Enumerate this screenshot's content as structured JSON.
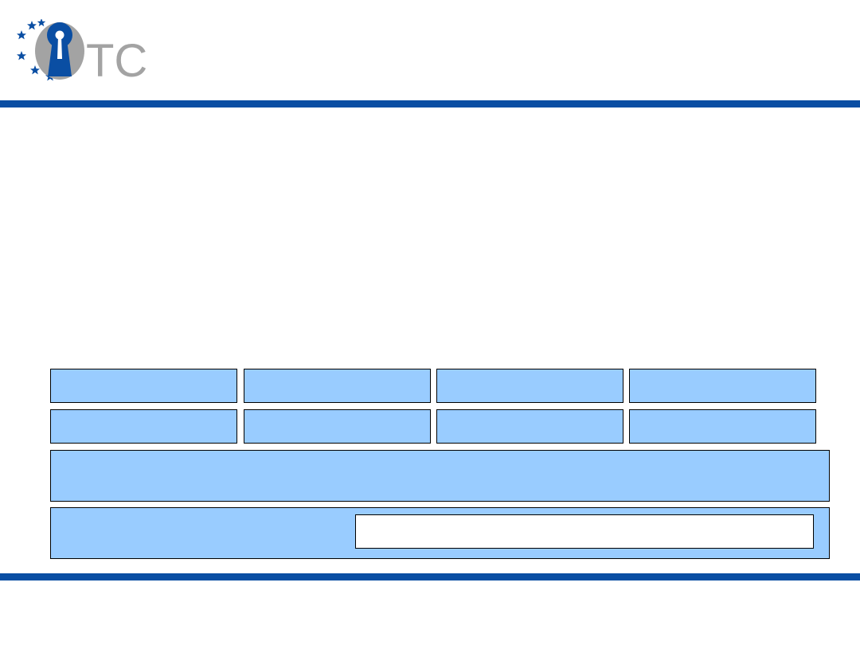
{
  "colors": {
    "brand_blue": "#0a4ea3",
    "logo_gray": "#a3a3a3",
    "cell_fill": "#99ccff",
    "border": "#000000",
    "background": "#ffffff"
  },
  "logo": {
    "text": "TC",
    "icons": [
      "keyhole-icon",
      "star-icon"
    ]
  }
}
